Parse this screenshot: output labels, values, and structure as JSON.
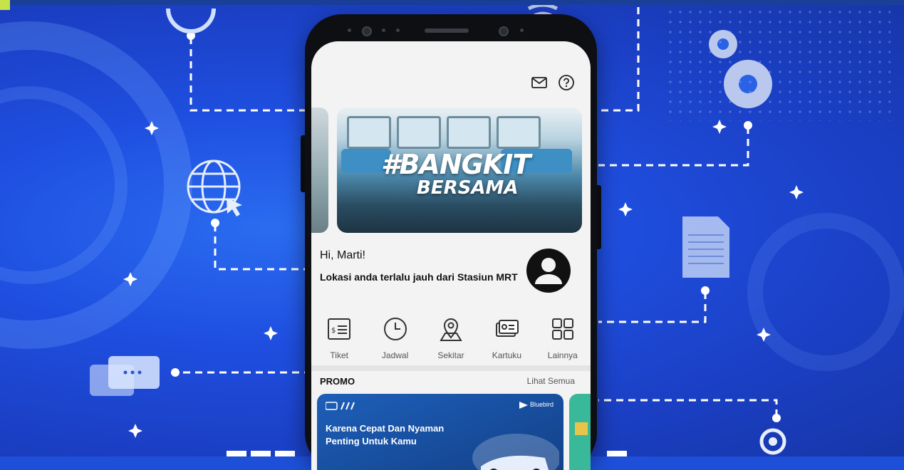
{
  "header": {
    "mail_icon": "mail-icon",
    "help_icon": "help-icon"
  },
  "banner": {
    "line1": "#BANGKIT",
    "line2": "BERSAMA"
  },
  "greeting": "Hi, Marti!",
  "location_message": "Lokasi anda terlalu jauh dari Stasiun MRT",
  "menu": [
    {
      "label": "Tiket",
      "icon": "ticket-icon"
    },
    {
      "label": "Jadwal",
      "icon": "clock-icon"
    },
    {
      "label": "Sekitar",
      "icon": "map-pin-icon"
    },
    {
      "label": "Kartuku",
      "icon": "card-icon"
    },
    {
      "label": "Lainnya",
      "icon": "grid-icon"
    }
  ],
  "promo": {
    "title": "PROMO",
    "see_all": "Lihat Semua",
    "card_brand": "Bluebird",
    "card_text": "Karena Cepat Dan Nyaman Penting Untuk Kamu"
  },
  "colors": {
    "background": "#1f4fe0",
    "phone": "#0e0f12",
    "screen": "#f3f3f3",
    "promo_card": "#1e5fb9"
  }
}
